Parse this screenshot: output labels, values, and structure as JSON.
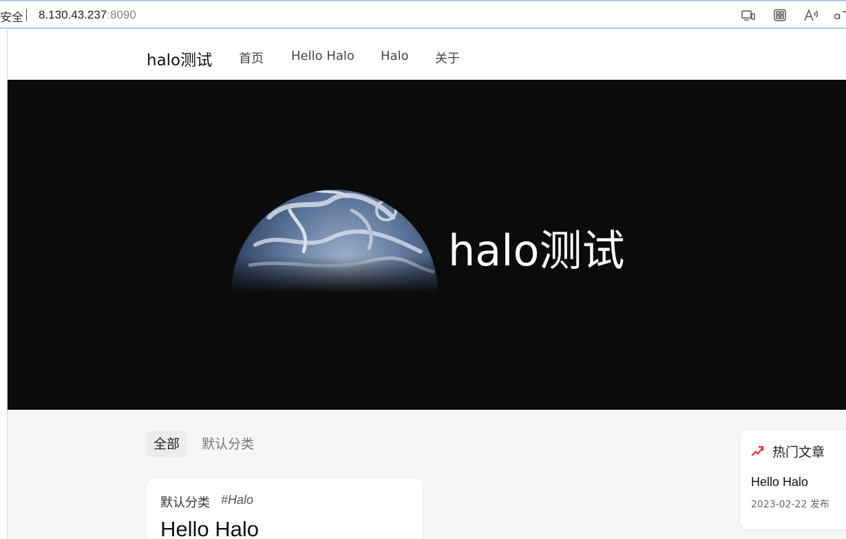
{
  "browser": {
    "security_label": "安全",
    "url_host": "8.130.43.237",
    "url_port": ":8090",
    "toolbar_icons": [
      "device-preview-icon",
      "qr-code-icon",
      "read-aloud-icon",
      "translate-icon"
    ]
  },
  "header": {
    "brand": "halo测试",
    "nav": [
      "首页",
      "Hello Halo",
      "Halo",
      "关于"
    ]
  },
  "hero": {
    "title": "halo测试"
  },
  "categories": {
    "tabs": [
      "全部",
      "默认分类"
    ],
    "active_index": 0
  },
  "post": {
    "category": "默认分类",
    "tag": "#Halo",
    "title": "Hello Halo"
  },
  "hot_articles": {
    "heading": "热门文章",
    "items": [
      {
        "title": "Hello Halo",
        "date": "2023-02-22 发布"
      }
    ]
  },
  "colors": {
    "accent": "#e5312f",
    "hero_bg": "#0b0b0c",
    "page_bg": "#f5f6f8"
  }
}
